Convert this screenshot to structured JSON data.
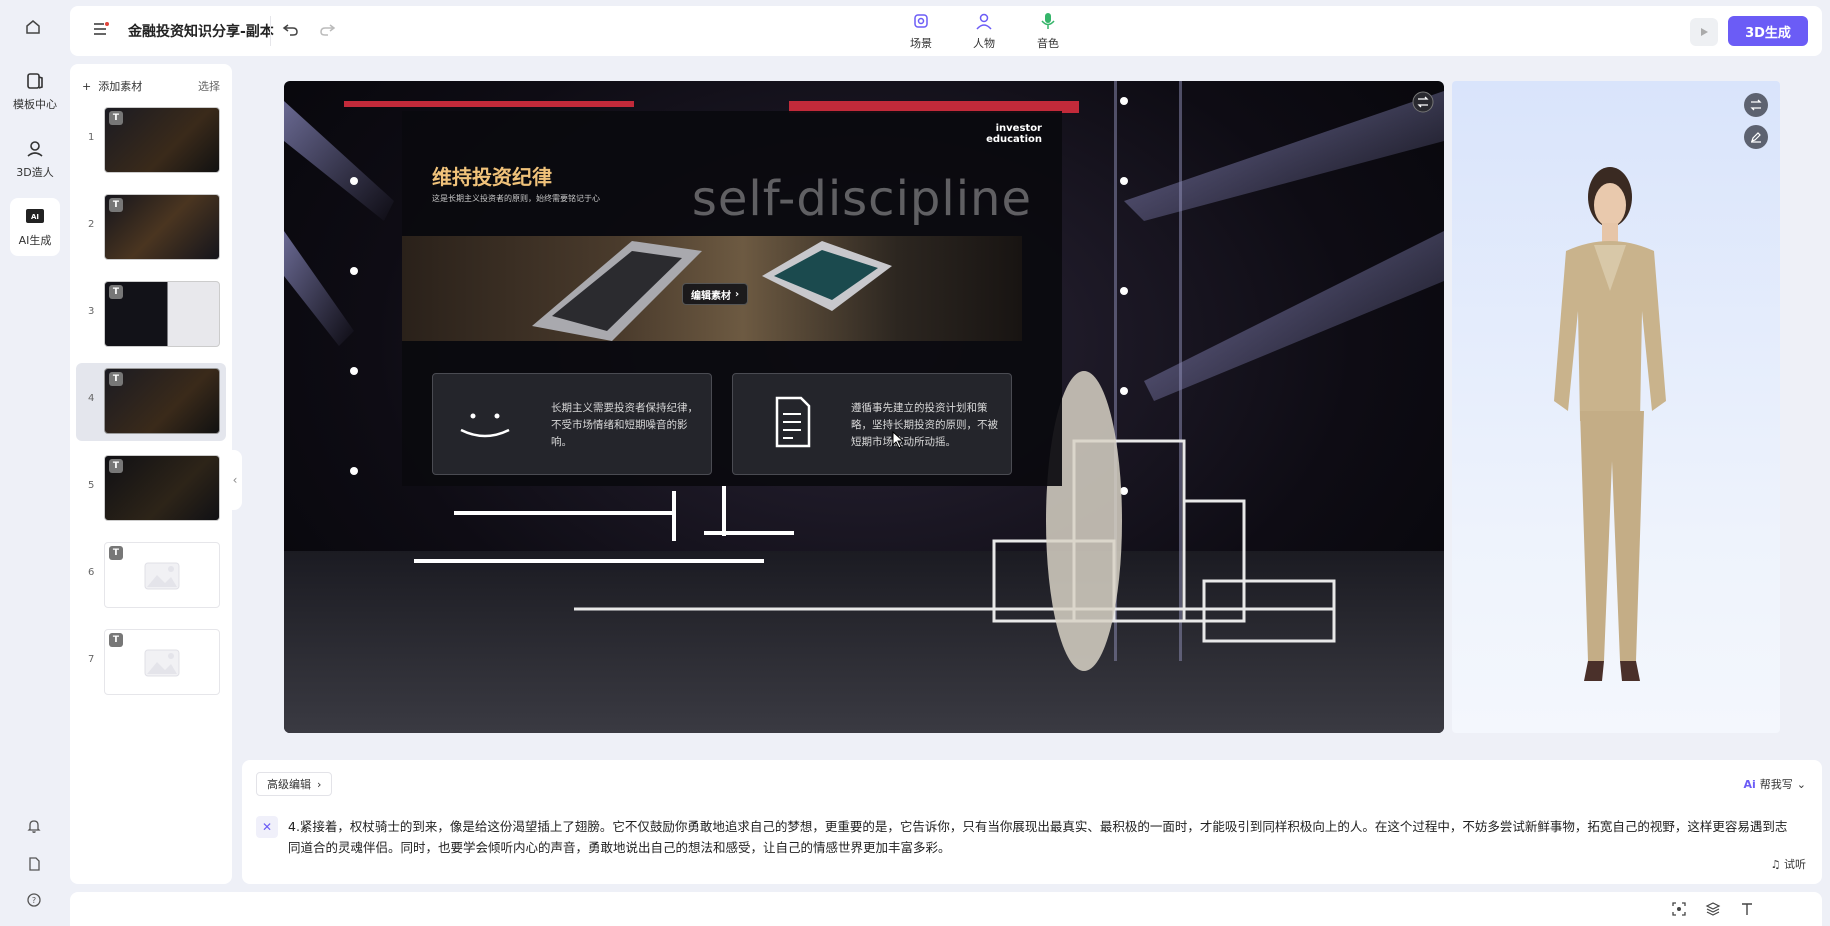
{
  "app": {
    "doc_title": "金融投资知识分享-副本",
    "generate_label": "3D生成"
  },
  "rail": {
    "items": [
      {
        "label": "模板中心"
      },
      {
        "label": "3D造人"
      },
      {
        "label": "AI生成"
      }
    ]
  },
  "toolbar": {
    "center": [
      {
        "label": "场景",
        "icon": "scene-icon"
      },
      {
        "label": "人物",
        "icon": "person-icon"
      },
      {
        "label": "音色",
        "icon": "microphone-icon"
      }
    ]
  },
  "slides_panel": {
    "add_label": "添加素材",
    "select_label": "选择",
    "slides": [
      {
        "num": "1",
        "filled": true
      },
      {
        "num": "2",
        "filled": true
      },
      {
        "num": "3",
        "filled": true
      },
      {
        "num": "4",
        "filled": true,
        "active": true
      },
      {
        "num": "5",
        "filled": true
      },
      {
        "num": "6",
        "filled": false
      },
      {
        "num": "7",
        "filled": false
      }
    ]
  },
  "stage": {
    "slide_title": "维持投资纪律",
    "slide_subtitle": "这是长期主义投资者的原则，始终需要铭记于心",
    "slide_tag_line1": "investor",
    "slide_tag_line2": "education",
    "slide_big_text": "self-discipline",
    "edit_material": "编辑素材",
    "card1_text": "长期主义需要投资者保持纪律，不受市场情绪和短期噪音的影响。",
    "card2_text": "遵循事先建立的投资计划和策略，坚持长期投资的原则，不被短期市场波动所动摇。"
  },
  "script": {
    "advanced_edit": "高级编辑",
    "help_write": "帮我写",
    "audition": "试听",
    "text": "4.紧接着，权杖骑士的到来，像是给这份渴望插上了翅膀。它不仅鼓励你勇敢地追求自己的梦想，更重要的是，它告诉你，只有当你展现出最真实、最积极的一面时，才能吸引到同样积极向上的人。在这个过程中，不妨多尝试新鲜事物，拓宽自己的视野，这样更容易遇到志同道合的灵魂伴侣。同时，也要学会倾听内心的声音，勇敢地说出自己的想法和感受，让自己的情感世界更加丰富多彩。"
  },
  "colors": {
    "accent": "#6b5cf6",
    "slide_title": "#f0c27a"
  }
}
